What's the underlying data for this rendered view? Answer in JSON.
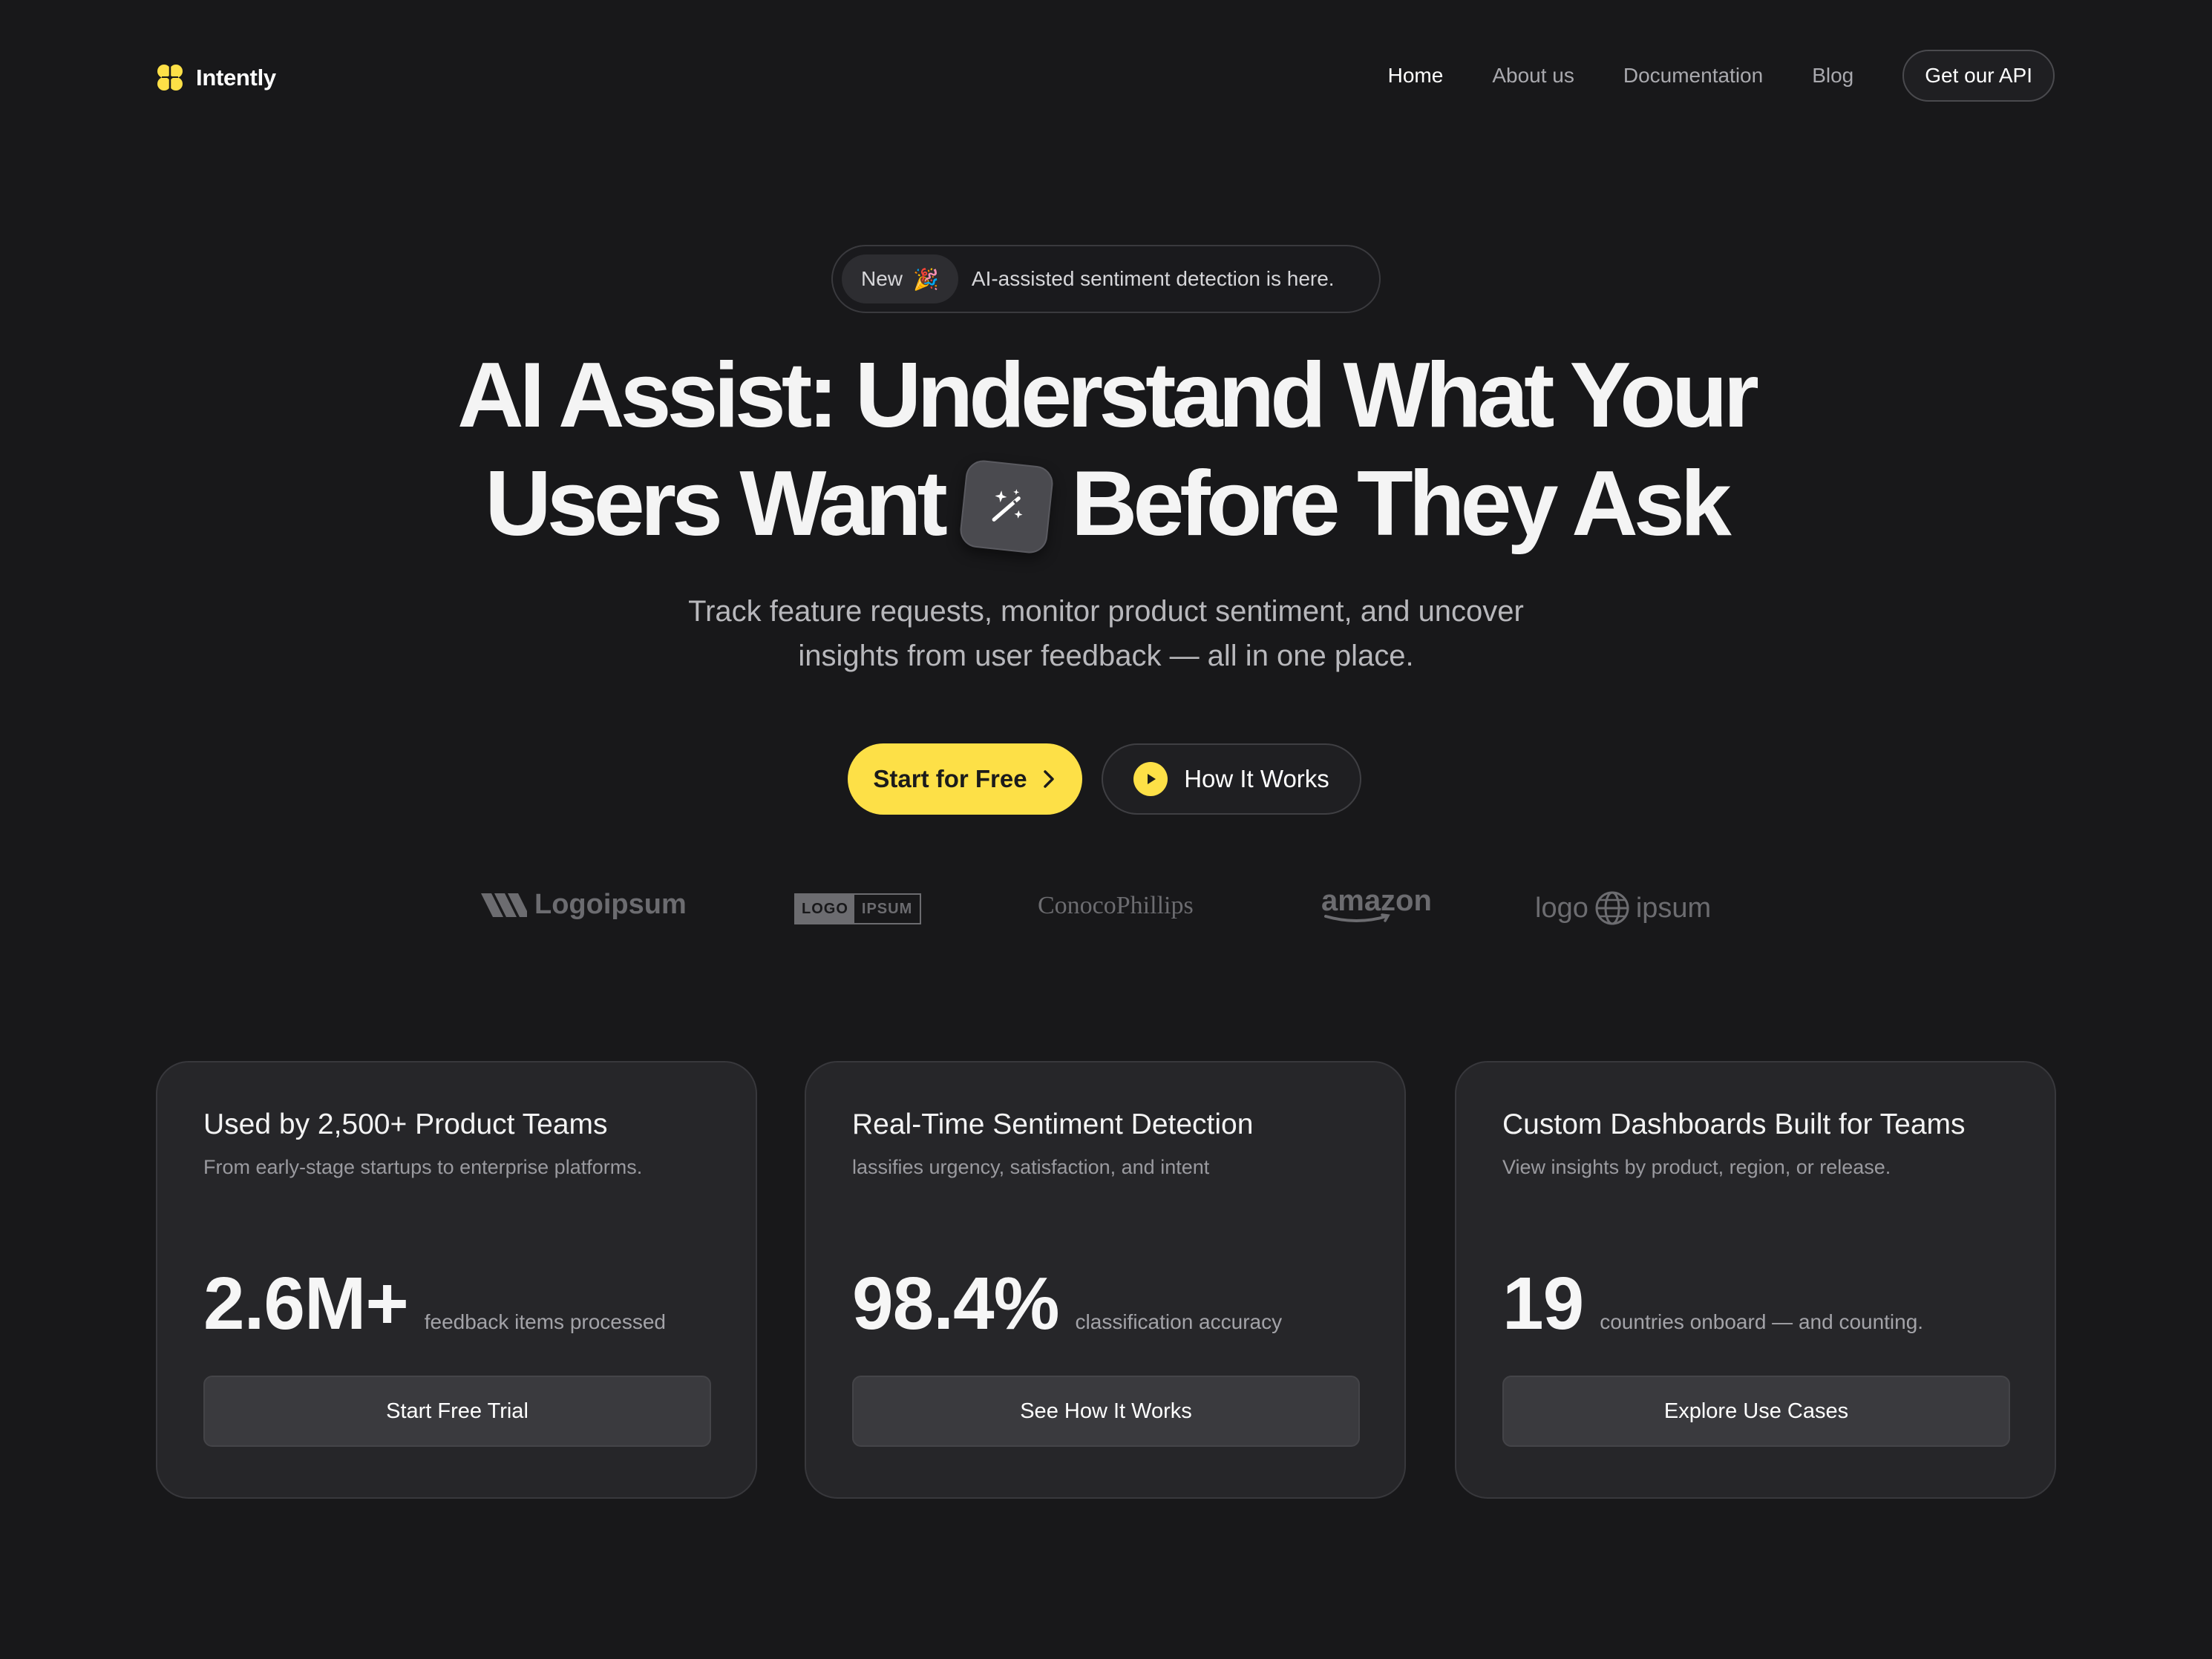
{
  "brand": {
    "name": "Intently",
    "accent": "#fde047"
  },
  "nav": {
    "links": [
      "Home",
      "About us",
      "Documentation",
      "Blog"
    ],
    "active": "Home",
    "cta": "Get our API"
  },
  "announcement": {
    "badge": "New",
    "emoji": "🎉",
    "text": "AI-assisted sentiment detection is here."
  },
  "hero": {
    "line1": "AI Assist: Understand What Your",
    "line2_a": "Users Want",
    "line2_b": "Before They Ask",
    "icon": "magic-wand-icon",
    "subtitle_1": "Track feature requests, monitor product sentiment, and uncover",
    "subtitle_2": "insights from user feedback — all in one place."
  },
  "cta": {
    "primary": "Start for Free",
    "secondary": "How It Works"
  },
  "logos": {
    "logo1": "Logoipsum",
    "logo2_a": "LOGO",
    "logo2_b": "IPSUM",
    "logo3": "ConocoPhillips",
    "logo4": "amazon",
    "logo5_a": "logo",
    "logo5_b": "ipsum"
  },
  "cards": [
    {
      "title": "Used by 2,500+ Product Teams",
      "desc": "From early-stage startups to enterprise platforms.",
      "stat": "2.6M+",
      "stat_label": "feedback items processed",
      "button": "Start Free Trial"
    },
    {
      "title": "Real-Time Sentiment Detection",
      "desc": "lassifies urgency, satisfaction, and intent",
      "stat": "98.4%",
      "stat_label": "classification accuracy",
      "button": "See How It Works"
    },
    {
      "title": "Custom Dashboards Built for Teams",
      "desc": "View insights by product, region, or release.",
      "stat": "19",
      "stat_label": "countries onboard — and counting.",
      "button": "Explore Use Cases"
    }
  ]
}
